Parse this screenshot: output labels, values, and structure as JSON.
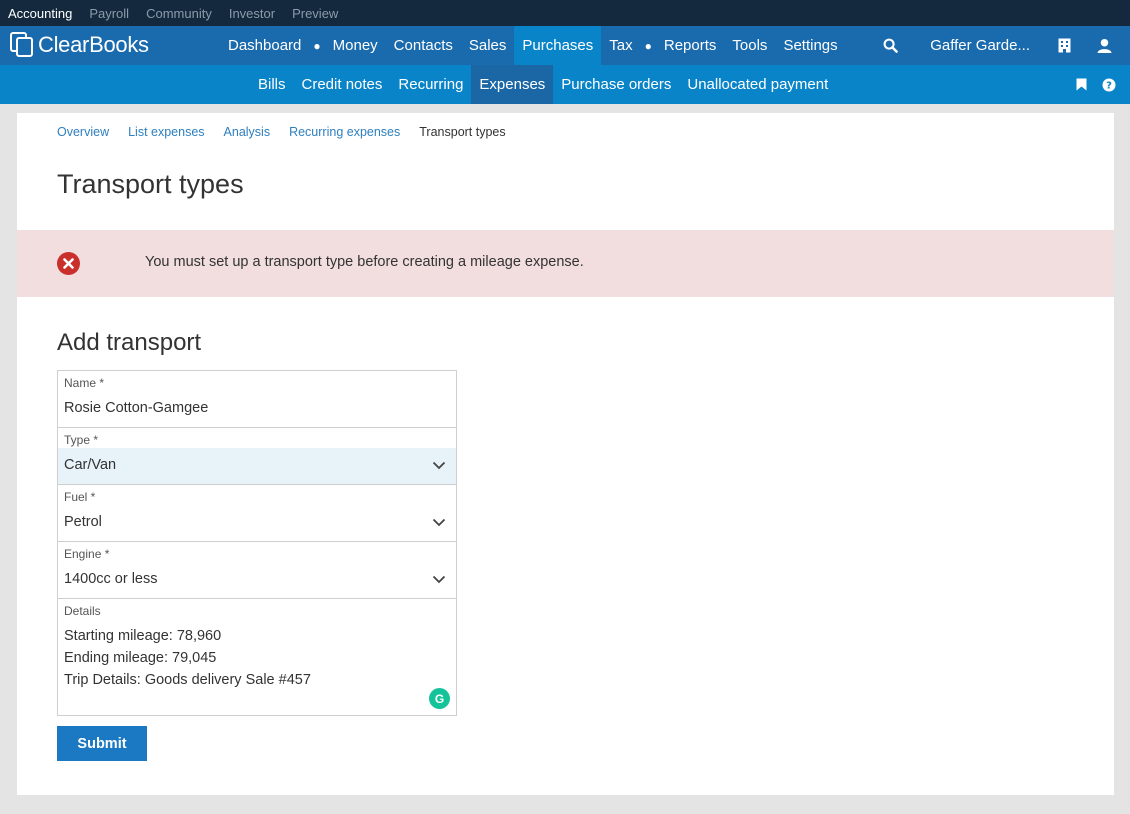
{
  "topbar": {
    "items": [
      {
        "label": "Accounting",
        "active": true
      },
      {
        "label": "Payroll"
      },
      {
        "label": "Community"
      },
      {
        "label": "Investor"
      },
      {
        "label": "Preview"
      }
    ]
  },
  "brand": {
    "name": "ClearBooks"
  },
  "mainnav": {
    "items": [
      "Dashboard",
      "Money",
      "Contacts",
      "Sales",
      "Purchases",
      "Tax",
      "Reports",
      "Tools",
      "Settings"
    ],
    "active": "Purchases",
    "org_name": "Gaffer Garde..."
  },
  "subnav": {
    "items": [
      "Bills",
      "Credit notes",
      "Recurring",
      "Expenses",
      "Purchase orders",
      "Unallocated payment"
    ],
    "active": "Expenses"
  },
  "breadcrumb": [
    "Overview",
    "List expenses",
    "Analysis",
    "Recurring expenses",
    "Transport types"
  ],
  "page": {
    "title": "Transport types",
    "alert": "You must set up a transport type before creating a mileage expense.",
    "section_title": "Add transport"
  },
  "form": {
    "name": {
      "label": "Name *",
      "value": "Rosie Cotton-Gamgee"
    },
    "type": {
      "label": "Type *",
      "value": "Car/Van"
    },
    "fuel": {
      "label": "Fuel *",
      "value": "Petrol"
    },
    "engine": {
      "label": "Engine *",
      "value": "1400cc or less"
    },
    "details": {
      "label": "Details",
      "lines": [
        "Starting mileage: 78,960",
        "Ending mileage: 79,045",
        "Trip Details: Goods delivery Sale #457"
      ]
    },
    "submit_label": "Submit"
  },
  "colors": {
    "topbar": "#14293d",
    "mainnav": "#1a6aae",
    "subnav": "#0a84c8",
    "alert_bg": "#f2dede",
    "alert_icon": "#c9302c",
    "primary_button": "#1b78c2"
  }
}
